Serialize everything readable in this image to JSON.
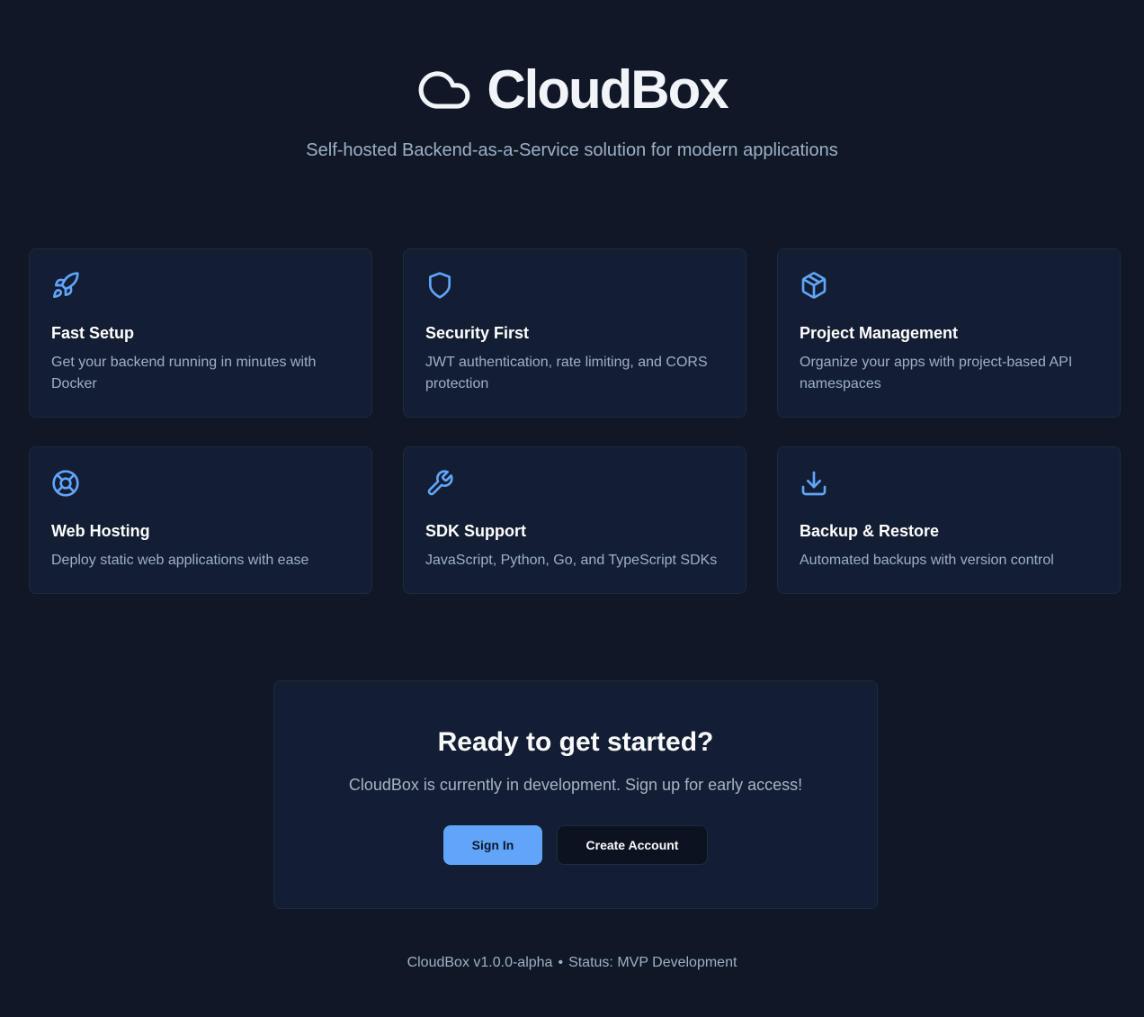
{
  "app": {
    "title": "CloudBox",
    "tagline": "Self-hosted Backend-as-a-Service solution for modern applications",
    "logo_icon": "cloud-icon"
  },
  "features": [
    {
      "icon": "rocket-icon",
      "title": "Fast Setup",
      "description": "Get your backend running in minutes with Docker"
    },
    {
      "icon": "shield-icon",
      "title": "Security First",
      "description": "JWT authentication, rate limiting, and CORS protection"
    },
    {
      "icon": "package-icon",
      "title": "Project Management",
      "description": "Organize your apps with project-based API namespaces"
    },
    {
      "icon": "lifebuoy-icon",
      "title": "Web Hosting",
      "description": "Deploy static web applications with ease"
    },
    {
      "icon": "wrench-icon",
      "title": "SDK Support",
      "description": "JavaScript, Python, Go, and TypeScript SDKs"
    },
    {
      "icon": "download-icon",
      "title": "Backup & Restore",
      "description": "Automated backups with version control"
    }
  ],
  "cta": {
    "title": "Ready to get started?",
    "subtitle": "CloudBox is currently in development. Sign up for early access!",
    "sign_in_label": "Sign In",
    "create_account_label": "Create Account"
  },
  "footer": {
    "version": "CloudBox v1.0.0-alpha",
    "separator": "•",
    "status": "Status: MVP Development"
  },
  "colors": {
    "background": "#101727",
    "card": "#131d33",
    "border": "#1e2a40",
    "accent": "#60a5fa",
    "muted_text": "#9fb0c6"
  }
}
